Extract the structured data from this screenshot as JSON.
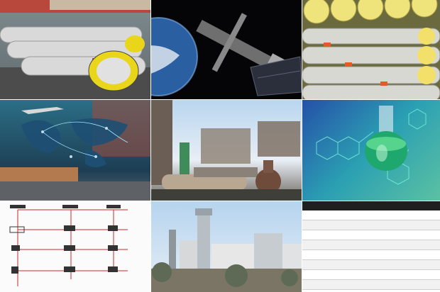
{
  "spec_table": {
    "headers": [
      "",
      "",
      "",
      ""
    ],
    "rows": [
      {
        "c1": "",
        "c2": "",
        "c3": "",
        "c4": ""
      },
      {
        "c1": "",
        "c2": "",
        "c3": "",
        "c4": ""
      },
      {
        "c1": "",
        "c2": "",
        "c3": "",
        "c4": ""
      },
      {
        "c1": "",
        "c2": "",
        "c3": "",
        "c4": ""
      },
      {
        "c1": "",
        "c2": "",
        "c3": "",
        "c4": ""
      },
      {
        "c1": "",
        "c2": "",
        "c3": "",
        "c4": ""
      },
      {
        "c1": "",
        "c2": "",
        "c3": "",
        "c4": ""
      },
      {
        "c1": "",
        "c2": "",
        "c3": "",
        "c4": ""
      },
      {
        "c1": "",
        "c2": "",
        "c3": "",
        "c4": ""
      }
    ]
  }
}
